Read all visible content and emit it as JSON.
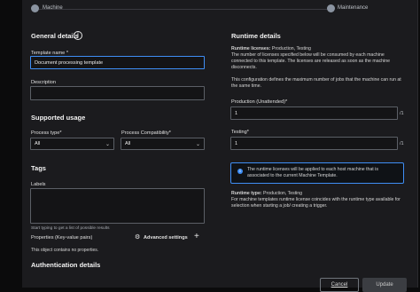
{
  "stepper": {
    "step1_label": "Machine",
    "step2_label": "Maintenance"
  },
  "general": {
    "title": "General details",
    "info_icon": "info-icon",
    "template_name_label": "Template name",
    "required_mark": "*",
    "template_name_value": "Document processing template",
    "description_label": "Description",
    "description_value": ""
  },
  "supported": {
    "title": "Supported usage",
    "process_type_label": "Process type*",
    "process_type_value": "All",
    "process_compat_label": "Process Compatibility*",
    "process_compat_value": "All"
  },
  "tags": {
    "title": "Tags",
    "labels_label": "Labels",
    "labels_hint": "Start typing to get a list of possible results",
    "properties_label": "Properties (Key-value pairs)",
    "advanced_settings": "Advanced settings",
    "no_properties": "This object contains no properties."
  },
  "auth": {
    "title": "Authentication details"
  },
  "runtime": {
    "title": "Runtime details",
    "licenses_label": "Runtime licenses:",
    "licenses_value": "Production, Testing",
    "licenses_desc": "The number of licenses specified below will be consumed by each machine connected to this template. The licenses are released as soon as the machine disconnects.",
    "config_desc": "This configuration defines the maximum number of jobs that the machine can run at the same time.",
    "production_label": "Production (Unattended)*",
    "production_value": "1",
    "production_suffix": "/1",
    "testing_label": "Testing*",
    "testing_value": "1",
    "testing_suffix": "/1",
    "info_text": "The runtime licenses will be applied to each host machine that is associated to the current Machine Template.",
    "runtime_type_label": "Runtime type:",
    "runtime_type_value": "Production, Testing",
    "runtime_type_desc": "For machine templates runtime license coincides with the runtime type available for selection when starting a job/ creating a trigger."
  },
  "footer": {
    "cancel": "Cancel",
    "update": "Update"
  },
  "colors": {
    "accent": "#3f8ef5",
    "panel": "#1b1b1e",
    "background": "#0b0b0c"
  }
}
